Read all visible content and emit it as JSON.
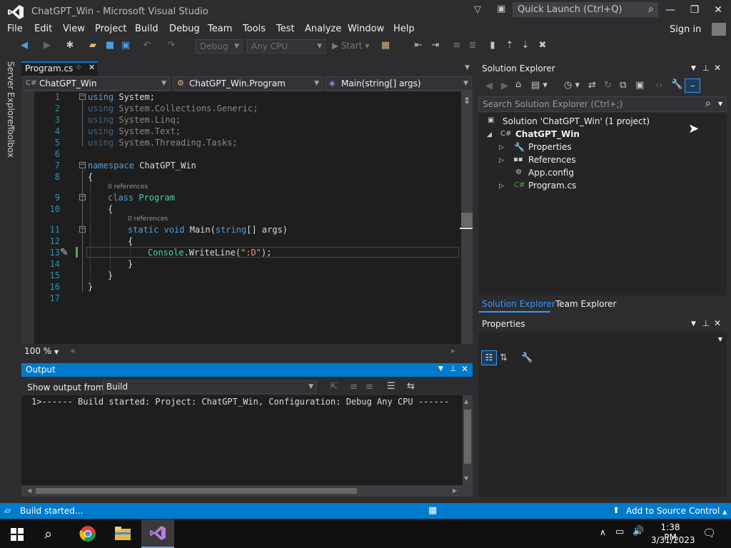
{
  "window": {
    "title": "ChatGPT_Win - Microsoft Visual Studio",
    "quick_launch_placeholder": "Quick Launch (Ctrl+Q)",
    "sign_in": "Sign in"
  },
  "menu": [
    "File",
    "Edit",
    "View",
    "Project",
    "Build",
    "Debug",
    "Team",
    "Tools",
    "Test",
    "Analyze",
    "Window",
    "Help"
  ],
  "toolbar": {
    "config": "Debug",
    "platform": "Any CPU",
    "start": "Start"
  },
  "side_tabs": [
    "Server Explorer",
    "Toolbox"
  ],
  "editor": {
    "tab": "Program.cs",
    "nav_project": "ChatGPT_Win",
    "nav_class": "ChatGPT_Win.Program",
    "nav_member": "Main(string[] args)",
    "zoom": "100 %",
    "references_label": "0 references",
    "line_numbers": [
      "1",
      "2",
      "3",
      "4",
      "5",
      "6",
      "7",
      "8",
      "9",
      "10",
      "11",
      "12",
      "13",
      "14",
      "15",
      "16",
      "17"
    ],
    "code": {
      "using": "using",
      "system": "System;",
      "l2": "System.Collections.Generic;",
      "l3": "System.Linq;",
      "l4": "System.Text;",
      "l5": "System.Threading.Tasks;",
      "namespace_kw": "namespace",
      "namespace_name": "ChatGPT_Win",
      "open_brace": "{",
      "close_brace": "}",
      "class_kw": "class",
      "class_name": "Program",
      "static_kw": "static",
      "void_kw": "void",
      "main_sig": "Main(",
      "string_kw": "string",
      "args": "[] args)",
      "console": "Console",
      "writeline": ".WriteLine(",
      "literal": "\":D\"",
      "end_call": ");"
    }
  },
  "output": {
    "title": "Output",
    "show_from_label": "Show output from:",
    "source": "Build",
    "line": "1>------ Build started: Project: ChatGPT_Win, Configuration: Debug Any CPU ------"
  },
  "solution_explorer": {
    "title": "Solution Explorer",
    "search_placeholder": "Search Solution Explorer (Ctrl+;)",
    "solution": "Solution 'ChatGPT_Win' (1 project)",
    "project": "ChatGPT_Win",
    "items": [
      "Properties",
      "References",
      "App.config",
      "Program.cs"
    ],
    "tabs": [
      "Solution Explorer",
      "Team Explorer"
    ]
  },
  "properties": {
    "title": "Properties"
  },
  "status": {
    "text": "Build started...",
    "source_control": "Add to Source Control"
  },
  "clock": {
    "time": "1:38 PM",
    "date": "3/31/2023"
  },
  "colors": {
    "accent": "#007acc",
    "editor_bg": "#1e1e1e",
    "chrome_bg": "#2d2d30"
  }
}
